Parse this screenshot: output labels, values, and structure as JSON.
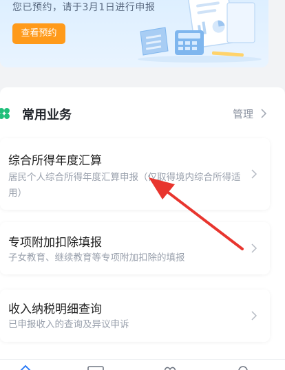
{
  "banner": {
    "notice": "您已预约，请于3月1日进行申报",
    "button_label": "查看预约"
  },
  "section": {
    "title": "常用业务",
    "manage_label": "管理"
  },
  "items": [
    {
      "title": "综合所得年度汇算",
      "description": "居民个人综合所得年度汇算申报（仅取得境内综合所得适用）"
    },
    {
      "title": "专项附加扣除填报",
      "description": "子女教育、继续教育等专项附加扣除的填报"
    },
    {
      "title": "收入纳税明细查询",
      "description": "已申报收入的查询及异议申诉"
    }
  ],
  "colors": {
    "accent_orange": "#ff9a1a",
    "clover_green": "#1fbf7a",
    "annotation_red": "#e8352e"
  },
  "icons": {
    "section": "clover-icon",
    "chevron": "chevron-right-icon"
  }
}
